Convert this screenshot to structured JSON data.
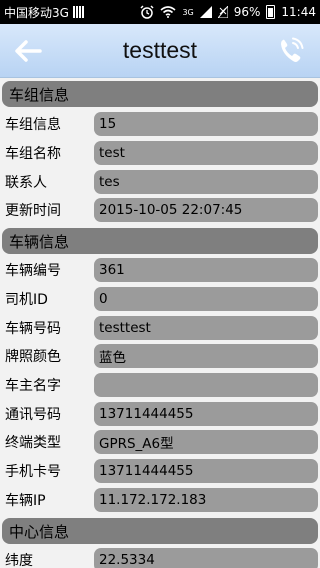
{
  "status_bar": {
    "carrier": "中国移动3G",
    "network": "3G",
    "battery": "96%",
    "time": "11:44"
  },
  "header": {
    "title": "testtest"
  },
  "sections": [
    {
      "title": "车组信息",
      "rows": [
        {
          "label": "车组信息",
          "value": "15"
        },
        {
          "label": "车组名称",
          "value": "test"
        },
        {
          "label": "联系人",
          "value": "tes"
        },
        {
          "label": "更新时间",
          "value": "2015-10-05 22:07:45"
        }
      ]
    },
    {
      "title": "车辆信息",
      "rows": [
        {
          "label": "车辆编号",
          "value": "361"
        },
        {
          "label": "司机ID",
          "value": "0"
        },
        {
          "label": "车辆号码",
          "value": "testtest"
        },
        {
          "label": "牌照颜色",
          "value": "蓝色"
        },
        {
          "label": "车主名字",
          "value": ""
        },
        {
          "label": "通讯号码",
          "value": "13711444455"
        },
        {
          "label": "终端类型",
          "value": "GPRS_A6型"
        },
        {
          "label": "手机卡号",
          "value": "13711444455"
        },
        {
          "label": "车辆IP",
          "value": "11.172.172.183"
        }
      ]
    },
    {
      "title": "中心信息",
      "rows": [
        {
          "label": "纬度",
          "value": "22.5334"
        }
      ]
    }
  ],
  "colors": {
    "header_bg": "#c9ddf7",
    "accent": "#ffffff",
    "section_bg": "#7f7f7f",
    "field_bg": "#9b9b9b",
    "page_bg": "#f2f2f2"
  },
  "icons": {
    "back": "arrow-left-icon",
    "call": "phone-icon"
  }
}
